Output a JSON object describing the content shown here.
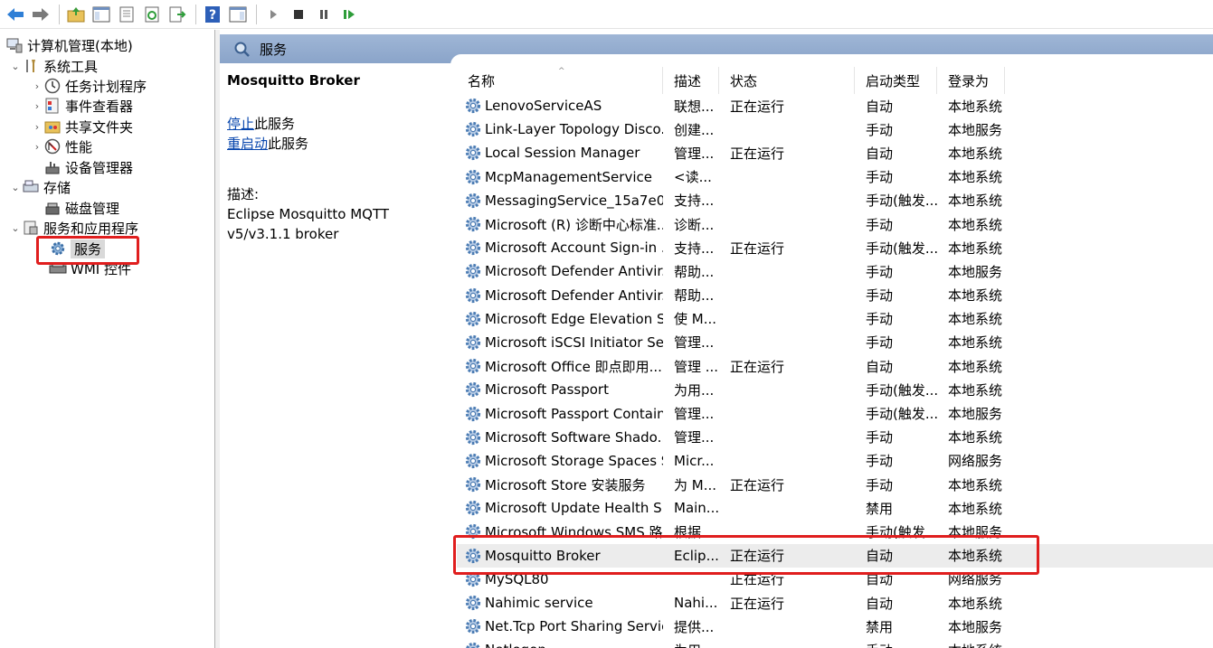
{
  "toolbar": {
    "buttons": [
      "back-icon",
      "forward-icon",
      "up-folder-icon",
      "show-hide-tree-icon",
      "properties-icon",
      "refresh-icon",
      "export-list-icon",
      "help-icon",
      "show-hide-action-pane-icon",
      "start-service-icon",
      "stop-service-icon",
      "pause-service-icon",
      "resume-service-icon"
    ]
  },
  "tree": {
    "root": "计算机管理(本地)",
    "system_tools": "系统工具",
    "task_scheduler": "任务计划程序",
    "event_viewer": "事件查看器",
    "shared_folders": "共享文件夹",
    "performance": "性能",
    "device_manager": "设备管理器",
    "storage": "存储",
    "disk_management": "磁盘管理",
    "services_apps": "服务和应用程序",
    "services": "服务",
    "wmi": "WMI 控件"
  },
  "header": {
    "title": "服务"
  },
  "detail": {
    "title": "Mosquitto Broker",
    "stop_link": "停止",
    "stop_suffix": "此服务",
    "restart_link": "重启动",
    "restart_suffix": "此服务",
    "desc_label": "描述:",
    "desc_line1": "Eclipse Mosquitto MQTT",
    "desc_line2": "v5/v3.1.1 broker"
  },
  "table": {
    "columns": {
      "name": "名称",
      "desc": "描述",
      "state": "状态",
      "start": "启动类型",
      "login": "登录为"
    },
    "sort_indicator": "^",
    "rows": [
      [
        "LenovoServiceAS",
        "联想...",
        "正在运行",
        "自动",
        "本地系统"
      ],
      [
        "Link-Layer Topology Disco...",
        "创建...",
        "",
        "手动",
        "本地服务"
      ],
      [
        "Local Session Manager",
        "管理...",
        "正在运行",
        "自动",
        "本地系统"
      ],
      [
        "McpManagementService",
        "<读...",
        "",
        "手动",
        "本地系统"
      ],
      [
        "MessagingService_15a7e0",
        "支持...",
        "",
        "手动(触发...",
        "本地系统"
      ],
      [
        "Microsoft (R) 诊断中心标准...",
        "诊断...",
        "",
        "手动",
        "本地系统"
      ],
      [
        "Microsoft Account Sign-in ...",
        "支持...",
        "正在运行",
        "手动(触发...",
        "本地系统"
      ],
      [
        "Microsoft Defender Antivir...",
        "帮助...",
        "",
        "手动",
        "本地服务"
      ],
      [
        "Microsoft Defender Antivir...",
        "帮助...",
        "",
        "手动",
        "本地系统"
      ],
      [
        "Microsoft Edge Elevation S...",
        "使 M...",
        "",
        "手动",
        "本地系统"
      ],
      [
        "Microsoft iSCSI Initiator Ser...",
        "管理...",
        "",
        "手动",
        "本地系统"
      ],
      [
        "Microsoft Office 即点即用...",
        "管理 ...",
        "正在运行",
        "自动",
        "本地系统"
      ],
      [
        "Microsoft Passport",
        "为用...",
        "",
        "手动(触发...",
        "本地系统"
      ],
      [
        "Microsoft Passport Container",
        "管理...",
        "",
        "手动(触发...",
        "本地服务"
      ],
      [
        "Microsoft Software Shado...",
        "管理...",
        "",
        "手动",
        "本地系统"
      ],
      [
        "Microsoft Storage Spaces S...",
        "Micr...",
        "",
        "手动",
        "网络服务"
      ],
      [
        "Microsoft Store 安装服务",
        "为 M...",
        "正在运行",
        "手动",
        "本地系统"
      ],
      [
        "Microsoft Update Health S...",
        "Main...",
        "",
        "禁用",
        "本地系统"
      ],
      [
        "Microsoft Windows SMS 路...",
        "根据...",
        "",
        "手动(触发...",
        "本地服务"
      ],
      [
        "Mosquitto Broker",
        "Eclip...",
        "正在运行",
        "自动",
        "本地系统"
      ],
      [
        "MySQL80",
        "",
        "正在运行",
        "自动",
        "网络服务"
      ],
      [
        "Nahimic service",
        "Nahi...",
        "正在运行",
        "自动",
        "本地系统"
      ],
      [
        "Net.Tcp Port Sharing Service",
        "提供...",
        "",
        "禁用",
        "本地服务"
      ],
      [
        "Netlogon",
        "为用...",
        "",
        "手动",
        "本地系统"
      ]
    ],
    "selected_row": 19
  },
  "colors": {
    "header_blue": "#9fb6d6",
    "highlight_red": "#e01e1e",
    "link": "#0645ad",
    "selected_row": "#ececec"
  }
}
